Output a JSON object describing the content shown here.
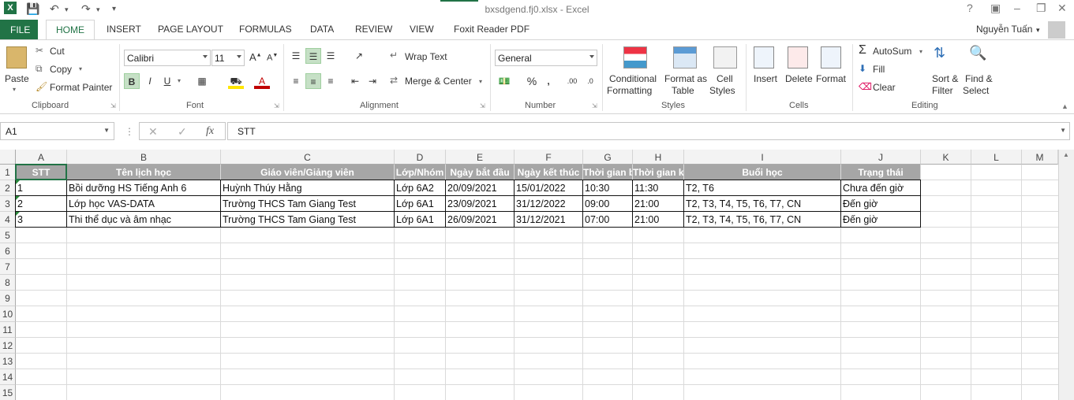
{
  "window": {
    "title": "bxsdgend.fj0.xlsx - Excel",
    "user": "Nguyễn Tuấn"
  },
  "tabs": [
    "FILE",
    "HOME",
    "INSERT",
    "PAGE LAYOUT",
    "FORMULAS",
    "DATA",
    "REVIEW",
    "VIEW",
    "Foxit Reader PDF"
  ],
  "ribbon": {
    "clipboard": {
      "paste": "Paste",
      "cut": "Cut",
      "copy": "Copy",
      "format_painter": "Format Painter",
      "label": "Clipboard"
    },
    "font": {
      "name": "Calibri",
      "size": "11",
      "label": "Font"
    },
    "alignment": {
      "wrap": "Wrap Text",
      "merge": "Merge & Center",
      "label": "Alignment"
    },
    "number": {
      "format": "General",
      "label": "Number"
    },
    "styles": {
      "conditional": "Conditional",
      "conditional2": "Formatting",
      "format_as": "Format as",
      "format_as2": "Table",
      "cell": "Cell",
      "cell2": "Styles",
      "label": "Styles"
    },
    "cells": {
      "insert": "Insert",
      "delete": "Delete",
      "format": "Format",
      "label": "Cells"
    },
    "editing": {
      "autosum": "AutoSum",
      "fill": "Fill",
      "clear": "Clear",
      "sort": "Sort &",
      "sort2": "Filter",
      "find": "Find &",
      "find2": "Select",
      "label": "Editing"
    }
  },
  "formula_bar": {
    "name_box": "A1",
    "fx": "fx",
    "value": "STT"
  },
  "columns": [
    "A",
    "B",
    "C",
    "D",
    "E",
    "F",
    "G",
    "H",
    "I",
    "J",
    "K",
    "L",
    "M"
  ],
  "rows": [
    "1",
    "2",
    "3",
    "4",
    "5",
    "6",
    "7",
    "8",
    "9",
    "10",
    "11",
    "12",
    "13",
    "14",
    "15"
  ],
  "table": {
    "headers": [
      "STT",
      "Tên lịch học",
      "Giáo viên/Giảng viên",
      "Lớp/Nhóm",
      "Ngày bắt đầu",
      "Ngày kết thúc",
      "Thời gian bắt",
      "Thời gian kết t",
      "Buổi học",
      "Trạng thái"
    ],
    "rows": [
      [
        "1",
        "Bồi dưỡng HS Tiếng Anh 6",
        "Huỳnh Thúy Hằng",
        "Lớp 6A2",
        "20/09/2021",
        "15/01/2022",
        "10:30",
        "11:30",
        "T2, T6",
        "Chưa đến giờ"
      ],
      [
        "2",
        "Lớp học VAS-DATA",
        "Trường THCS Tam Giang Test",
        "Lớp 6A1",
        "23/09/2021",
        "31/12/2022",
        "09:00",
        "21:00",
        " T2, T3, T4, T5, T6, T7, CN",
        "Đến giờ"
      ],
      [
        "3",
        "Thi thể dục và âm nhạc",
        "Trường THCS Tam Giang Test",
        "Lớp 6A1",
        "26/09/2021",
        "31/12/2021",
        "07:00",
        "21:00",
        " T2, T3, T4, T5, T6, T7, CN",
        "Đến giờ"
      ]
    ]
  },
  "colors": {
    "accent": "#217346",
    "header_fill": "#a6a6a6"
  }
}
